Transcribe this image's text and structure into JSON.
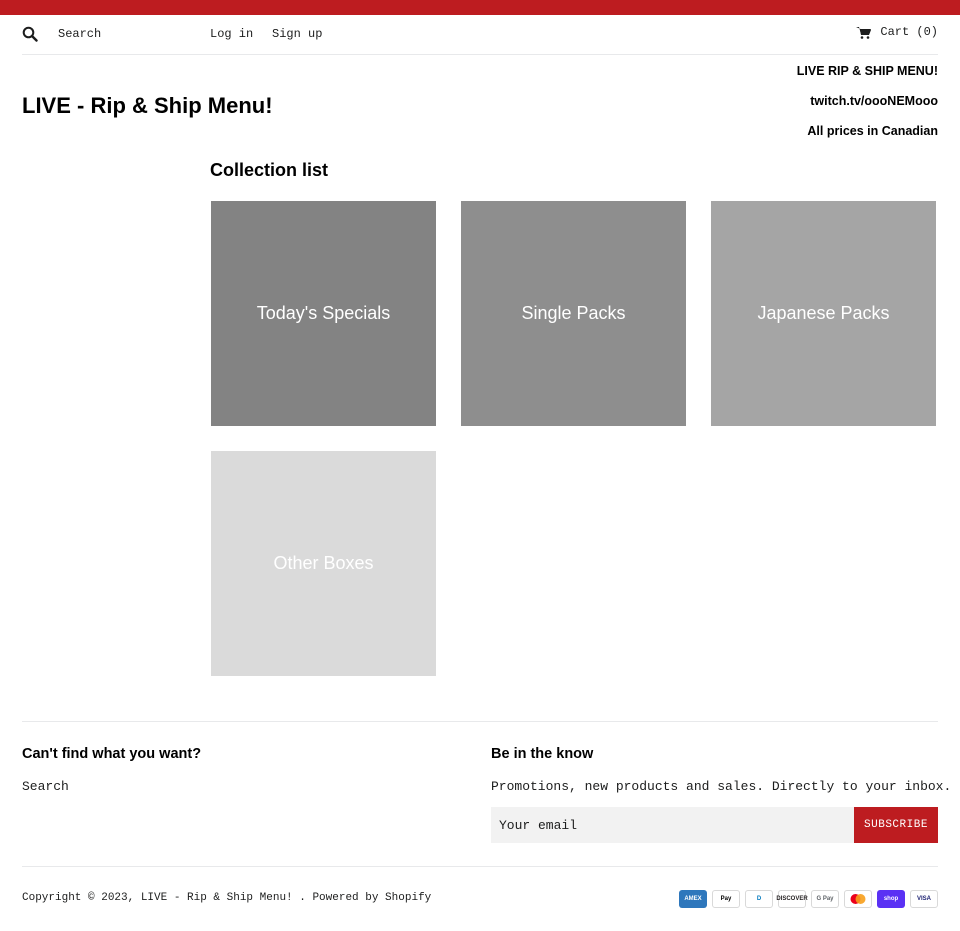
{
  "header": {
    "search_placeholder": "Search",
    "login_label": "Log in",
    "signup_label": "Sign up",
    "cart_label": "Cart (0)"
  },
  "site": {
    "title": "LIVE - Rip & Ship Menu!",
    "notes": [
      "LIVE RIP & SHIP MENU!",
      "twitch.tv/oooNEMooo",
      "All prices in Canadian"
    ]
  },
  "collections": {
    "title": "Collection list",
    "items": [
      {
        "label": "Today's Specials",
        "bg": "#838383"
      },
      {
        "label": "Single Packs",
        "bg": "#8e8e8e"
      },
      {
        "label": "Japanese Packs",
        "bg": "#a5a5a5"
      },
      {
        "label": "Other Boxes",
        "bg": "#dadada"
      }
    ]
  },
  "footer": {
    "cant_find_heading": "Can't find what you want?",
    "search_link": "Search",
    "know_heading": "Be in the know",
    "promo_text": "Promotions, new products and sales. Directly to your inbox.",
    "email_placeholder": "Your email",
    "subscribe_label": "SUBSCRIBE",
    "copyright": "Copyright © 2023, LIVE - Rip & Ship Menu! . Powered by Shopify",
    "payments": [
      {
        "name": "American Express",
        "label": "AMEX",
        "bg": "#2e77bc",
        "fg": "#ffffff"
      },
      {
        "name": "Apple Pay",
        "label": "Pay",
        "bg": "#ffffff",
        "fg": "#000000"
      },
      {
        "name": "Diners Club",
        "label": "D",
        "bg": "#ffffff",
        "fg": "#0079be"
      },
      {
        "name": "Discover",
        "label": "DISCOVER",
        "bg": "#ffffff",
        "fg": "#231f20"
      },
      {
        "name": "Google Pay",
        "label": "G Pay",
        "bg": "#ffffff",
        "fg": "#5f6368"
      },
      {
        "name": "Mastercard",
        "label": "",
        "bg": "#ffffff",
        "fg": "#eb001b"
      },
      {
        "name": "Shop Pay",
        "label": "shop",
        "bg": "#5a31f4",
        "fg": "#ffffff"
      },
      {
        "name": "Visa",
        "label": "VISA",
        "bg": "#ffffff",
        "fg": "#1a1f71"
      }
    ]
  },
  "colors": {
    "accent": "#bd1c20",
    "footer_input_bg": "#f2f2f2"
  }
}
